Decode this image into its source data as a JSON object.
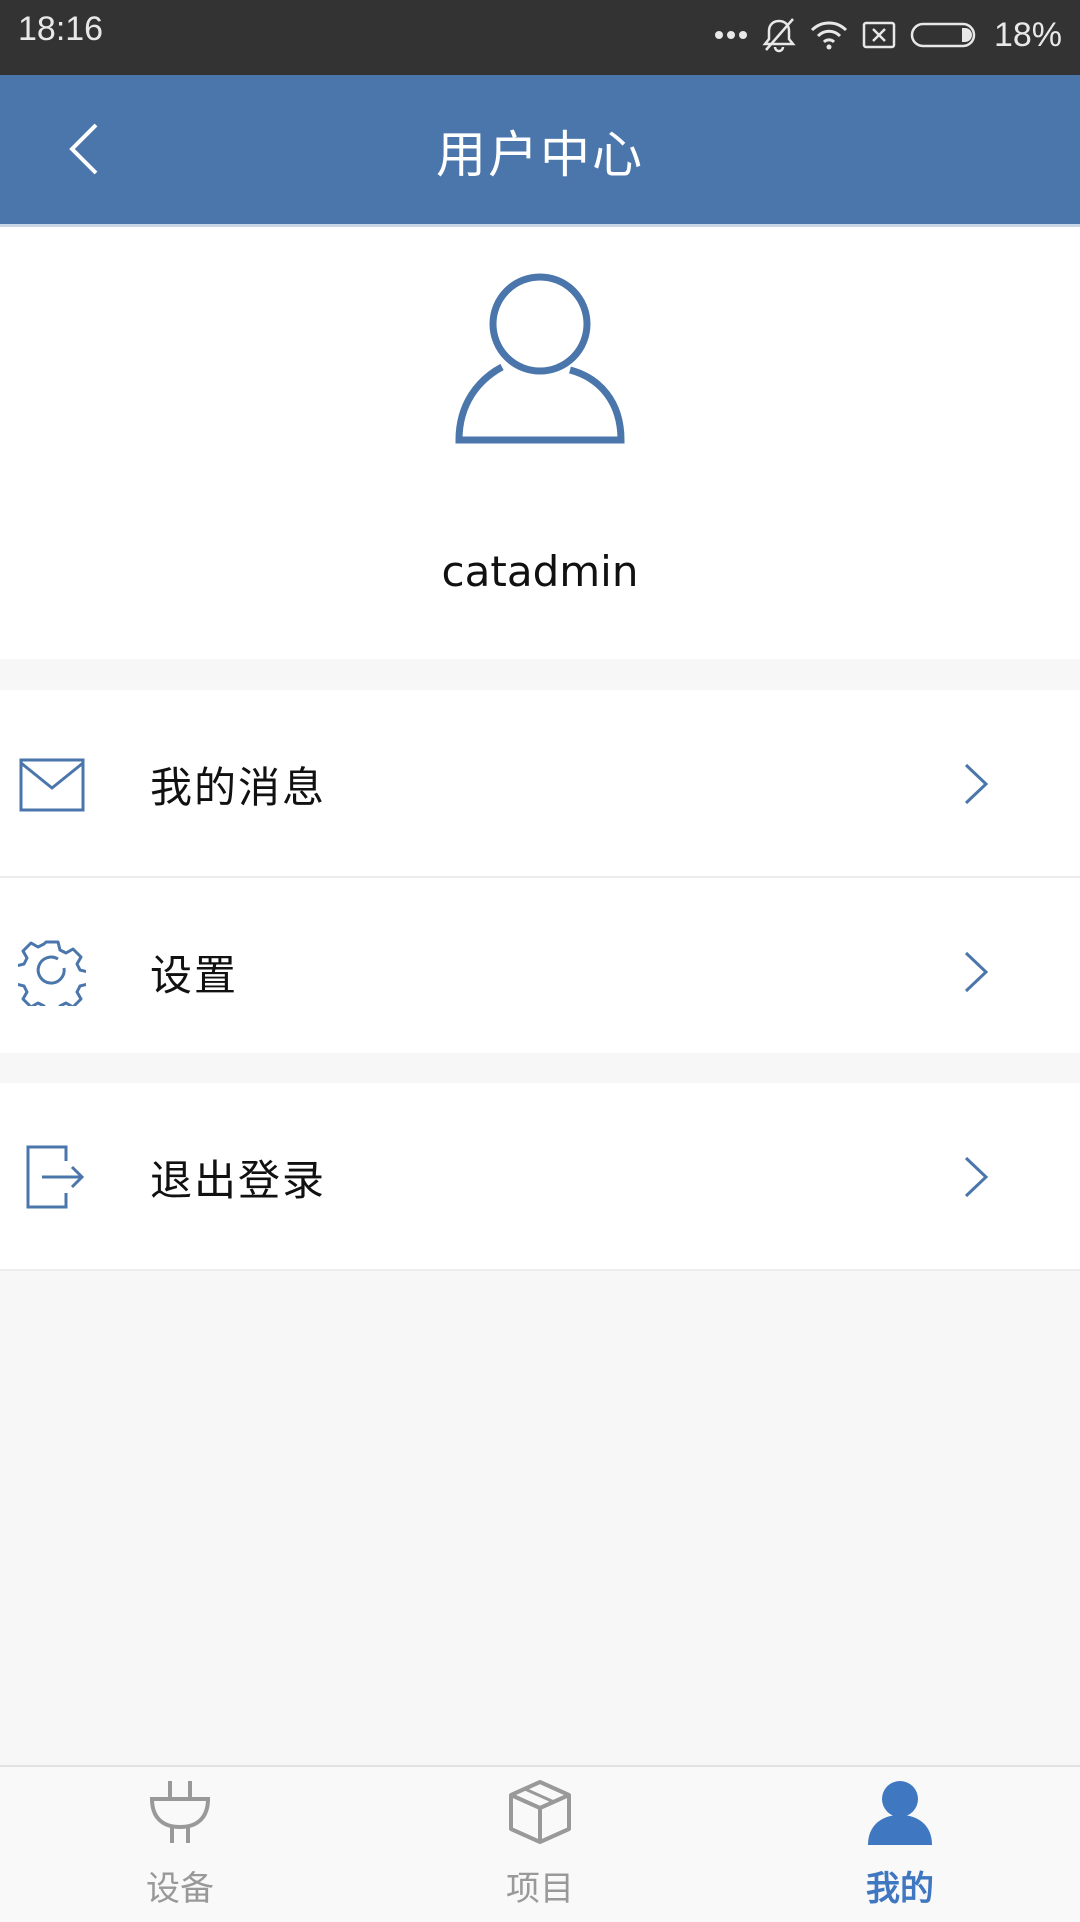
{
  "status_bar": {
    "time": "18:16",
    "battery": "18%"
  },
  "header": {
    "title": "用户中心"
  },
  "profile": {
    "username": "catadmin"
  },
  "menu": [
    {
      "label": "我的消息",
      "icon": "mail-icon"
    },
    {
      "label": "设置",
      "icon": "gear-icon"
    },
    {
      "label": "退出登录",
      "icon": "logout-icon"
    }
  ],
  "tabs": [
    {
      "label": "设备",
      "icon": "plug-icon",
      "active": false
    },
    {
      "label": "项目",
      "icon": "box-icon",
      "active": false
    },
    {
      "label": "我的",
      "icon": "person-icon",
      "active": true
    }
  ],
  "colors": {
    "header": "#4a76ab",
    "accent": "#3f78c1",
    "status_bar": "#333333"
  }
}
